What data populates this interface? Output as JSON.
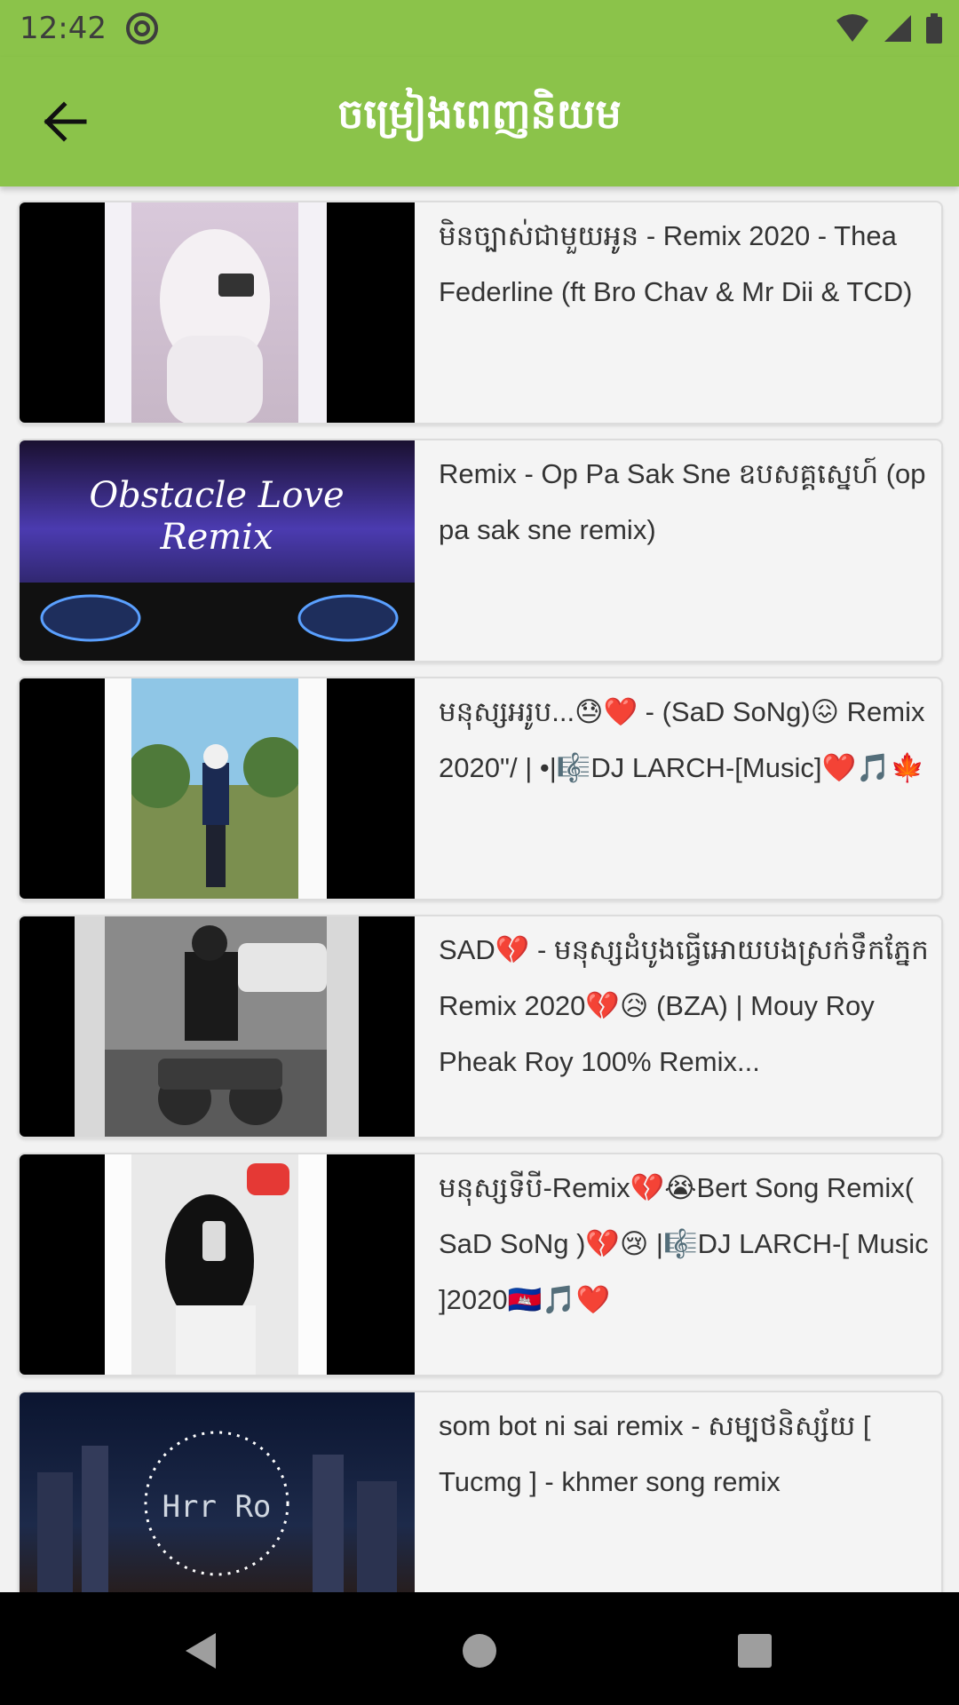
{
  "status_bar": {
    "time": "12:42"
  },
  "app_bar": {
    "title": "ចម្រៀងពេញនិយម",
    "back_icon": "arrow-left-icon"
  },
  "songs": [
    {
      "title": "មិនច្បាស់ជាមួយអូន - Remix 2020 - Thea Federline (ft Bro Chav & Mr Dii & TCD)"
    },
    {
      "title": "Remix - Op Pa Sak Sne ឧបសគ្គស្នេហ៍ (op pa sak sne remix)",
      "thumb_text": "Obstacle Love Remix"
    },
    {
      "title": "មនុស្សអរូប...😓❤️ - (SaD SoNg)😖 Remix 2020\"/ | •|🎼DJ LARCH-[Music]❤️🎵🍁"
    },
    {
      "title": "SAD💔 - មនុស្សដំបូងធ្វើអោយបងស្រក់ទឹកភ្នែក Remix 2020💔😥 (BZA) | Mouy Roy Pheak Roy 100% Remix..."
    },
    {
      "title": "មនុស្សទីបី-Remix💔😭Bert Song Remix( SaD SoNg )💔😢 |🎼DJ LARCH-[ Music ]2020🇰🇭🎵❤️"
    },
    {
      "title": "som bot ni sai remix - សម្បថនិស្ស័យ [ Tucmg ] - khmer song remix",
      "thumb_text": "Hrr Ro"
    }
  ],
  "colors": {
    "app_bar": "#8bc34a",
    "background": "#f2f2f2"
  }
}
